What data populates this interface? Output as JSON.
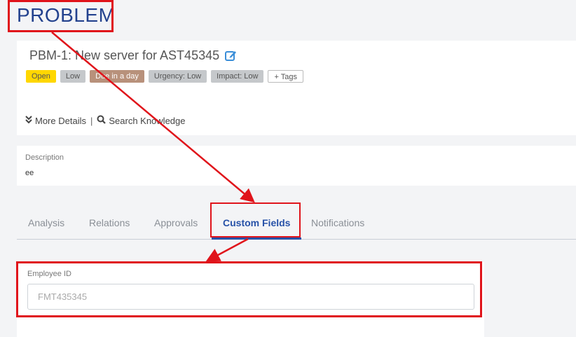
{
  "page": {
    "title": "PROBLEM"
  },
  "problem": {
    "heading": "PBM-1: New server for AST45345",
    "tags": [
      {
        "label": "Open"
      },
      {
        "label": "Low"
      },
      {
        "label": "Due in a day"
      },
      {
        "label": "Urgency: Low"
      },
      {
        "label": "Impact: Low"
      },
      {
        "label": "+ Tags"
      }
    ],
    "more_details_label": "More Details",
    "separator": "|",
    "search_knowledge_label": "Search Knowledge"
  },
  "description": {
    "label": "Description",
    "value": "ee"
  },
  "tabs": [
    {
      "label": "Analysis"
    },
    {
      "label": "Relations"
    },
    {
      "label": "Approvals"
    },
    {
      "label": "Custom Fields",
      "active": true
    },
    {
      "label": "Notifications"
    }
  ],
  "custom_fields": {
    "employee_id": {
      "label": "Employee ID",
      "placeholder": "FMT435345",
      "value": ""
    }
  },
  "colors": {
    "title": "#23428e",
    "annotation": "#e0141b",
    "active_tab": "#2752a8",
    "tag_open": "#ffd700",
    "tag_due": "#b8917b",
    "tag_grey": "#c5c8cb"
  },
  "icons": {
    "edit": "edit-icon",
    "more_details": "double-chevron-down-icon",
    "search": "search-icon"
  }
}
